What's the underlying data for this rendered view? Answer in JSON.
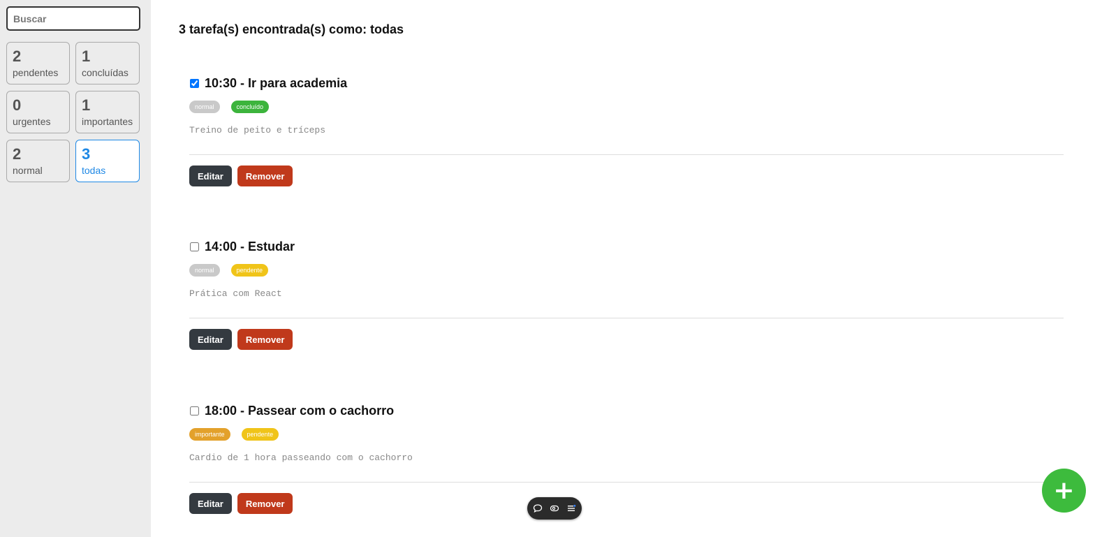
{
  "search": {
    "placeholder": "Buscar"
  },
  "filters": [
    {
      "count": "2",
      "label": "pendentes"
    },
    {
      "count": "1",
      "label": "concluídas"
    },
    {
      "count": "0",
      "label": "urgentes"
    },
    {
      "count": "1",
      "label": "importantes"
    },
    {
      "count": "2",
      "label": "normal"
    },
    {
      "count": "3",
      "label": "todas"
    }
  ],
  "heading": "3 tarefa(s) encontrada(s) como: todas",
  "tasks": [
    {
      "checked": true,
      "title": "10:30 - Ir para academia",
      "priority": "normal",
      "status": "concluído",
      "description": "Treino de peito e tríceps",
      "edit_label": "Editar",
      "remove_label": "Remover"
    },
    {
      "checked": false,
      "title": "14:00 - Estudar",
      "priority": "normal",
      "status": "pendente",
      "description": "Prática com React",
      "edit_label": "Editar",
      "remove_label": "Remover"
    },
    {
      "checked": false,
      "title": "18:00 - Passear com o cachorro",
      "priority": "importante",
      "status": "pendente",
      "description": "Cardio de 1 hora passeando com o cachorro",
      "edit_label": "Editar",
      "remove_label": "Remover"
    }
  ],
  "fab": {
    "label": "+"
  },
  "colors": {
    "active_filter": "#1e88e5",
    "concluido": "#3cb43c",
    "pendente": "#f0c419",
    "importante": "#e3a12b",
    "normal": "#c9c9c9",
    "edit": "#343a40",
    "remove": "#c0391b",
    "fab": "#3dbb3d"
  },
  "toolbar_icons": [
    "comment-icon",
    "eye-icon",
    "menu-icon"
  ]
}
